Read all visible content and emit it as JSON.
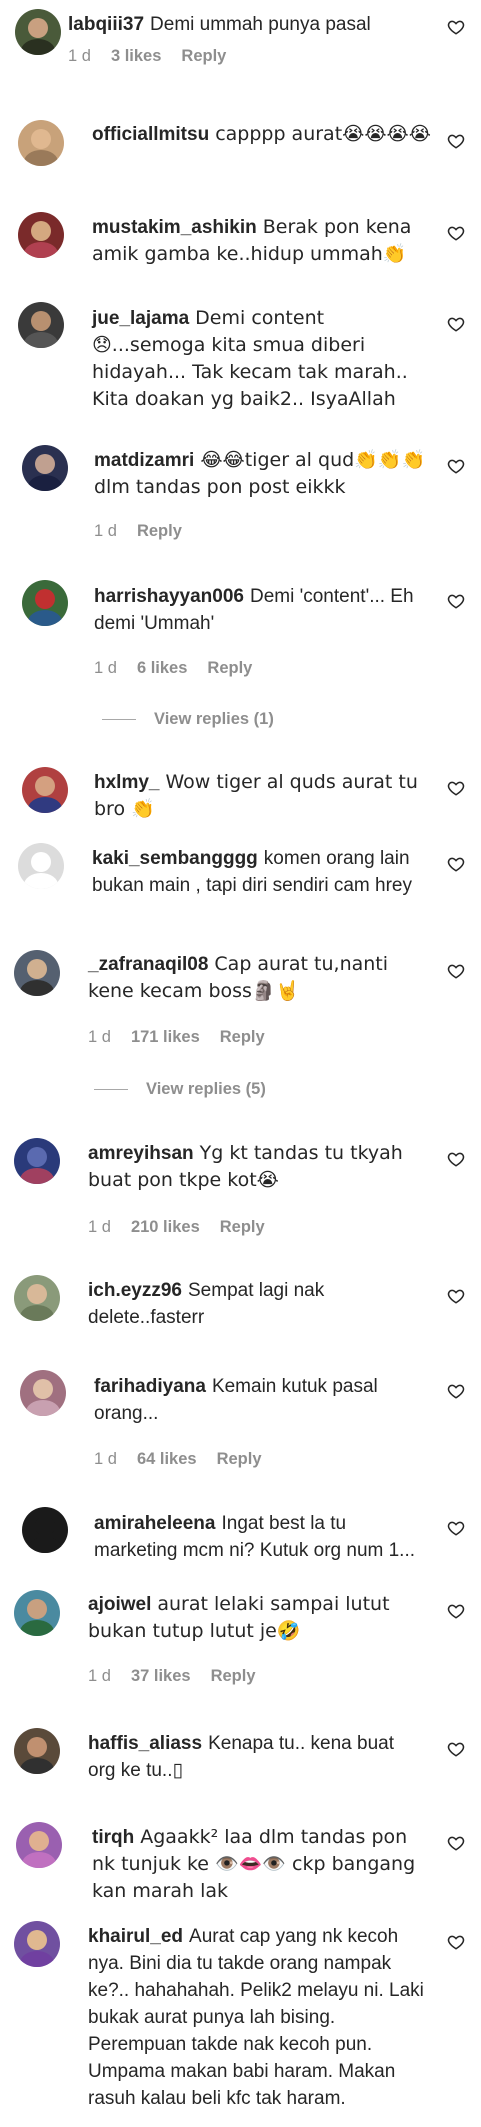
{
  "comments": [
    {
      "username": "labqiii37",
      "text": "Demi ummah punya pasal",
      "time": "1 d",
      "likes": "3 likes",
      "reply": "Reply"
    },
    {
      "username": "officiallmitsu",
      "text": "capppp aurat😭😭😭😭"
    },
    {
      "username": "mustakim_ashikin",
      "text": "Berak pon kena amik gamba ke..hidup ummah👏"
    },
    {
      "username": "jue_lajama",
      "text": "Demi content 😞...semoga kita smua diberi hidayah... Tak kecam tak marah.. Kita doakan yg baik2.. IsyaAllah"
    },
    {
      "username": "matdizamri",
      "text": "😂😂tiger al qud👏👏👏dlm tandas pon post eikkk",
      "time": "1 d",
      "reply": "Reply"
    },
    {
      "username": "harrishayyan006",
      "text": "Demi 'content'... Eh demi 'Ummah'",
      "time": "1 d",
      "likes": "6 likes",
      "reply": "Reply",
      "view_replies": "View replies (1)"
    },
    {
      "username": "hxlmy_",
      "text": "Wow tiger al quds aurat tu bro 👏"
    },
    {
      "username": "kaki_sembangggg",
      "text": "komen orang lain bukan main , tapi diri sendiri cam hrey"
    },
    {
      "username": "_zafranaqil08",
      "text": "Cap aurat tu,nanti kene kecam boss🗿🤘",
      "time": "1 d",
      "likes": "171 likes",
      "reply": "Reply",
      "view_replies": "View replies (5)"
    },
    {
      "username": "amreyihsan",
      "text": "Yg kt tandas tu tkyah buat pon tkpe kot😭",
      "time": "1 d",
      "likes": "210 likes",
      "reply": "Reply"
    },
    {
      "username": "ich.eyzz96",
      "text": "Sempat lagi nak delete..fasterr"
    },
    {
      "username": "farihadiyana",
      "text": "Kemain kutuk pasal orang...",
      "time": "1 d",
      "likes": "64 likes",
      "reply": "Reply"
    },
    {
      "username": "amiraheleena",
      "text": "Ingat best la tu marketing mcm ni? Kutuk org num 1..."
    },
    {
      "username": "ajoiwel",
      "text": "aurat lelaki sampai lutut bukan tutup lutut je🤣",
      "time": "1 d",
      "likes": "37 likes",
      "reply": "Reply"
    },
    {
      "username": "haffis_aliass",
      "text": "Kenapa tu.. kena buat org ke tu..▯"
    },
    {
      "username": "tirqh",
      "text": "Agaakk² laa dlm tandas pon nk tunjuk ke 👁️👄👁️ ckp bangang kan marah lak"
    },
    {
      "username": "khairul_ed",
      "text": "Aurat cap yang nk kecoh nya. Bini dia tu takde orang nampak ke?.. hahahahah. Pelik2 melayu ni. Laki bukak aurat punya lah bising. Perempuan takde nak kecoh pun. Umpama makan babi haram. Makan rasuh kalau beli kfc tak haram."
    }
  ],
  "avatar_colors": [
    "#4a5a3a",
    "#c8a27a",
    "#7a2a2a",
    "#3a3a3a",
    "#2a3050",
    "#3a6a3a",
    "#b04040",
    "#c8c8c8",
    "#556070",
    "#2a3a7a",
    "#8a9a7a",
    "#a07080",
    "#1a1a1a",
    "#4a8aa0",
    "#5a4a3a",
    "#9a60b0",
    "#7050a0"
  ]
}
